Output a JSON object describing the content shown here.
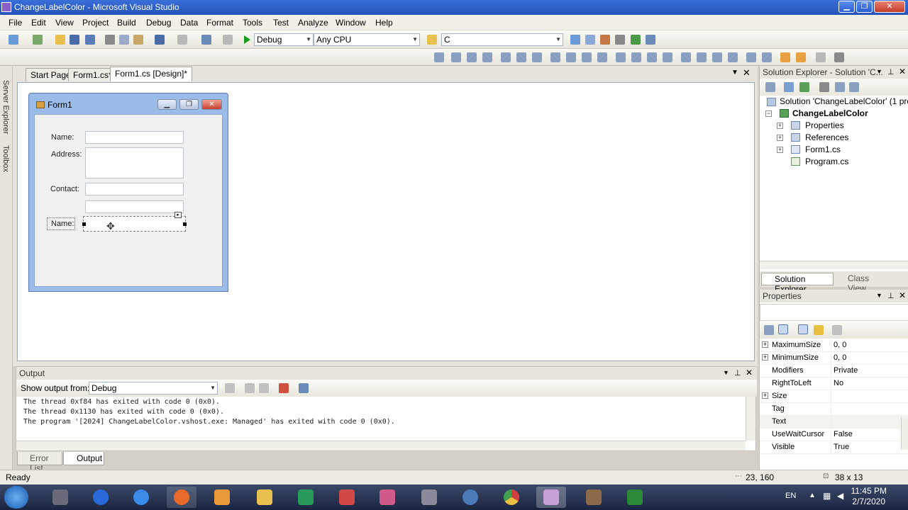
{
  "window": {
    "title": "ChangeLabelColor - Microsoft Visual Studio"
  },
  "menu": [
    "File",
    "Edit",
    "View",
    "Project",
    "Build",
    "Debug",
    "Data",
    "Format",
    "Tools",
    "Test",
    "Analyze",
    "Window",
    "Help"
  ],
  "toolbar": {
    "config": "Debug",
    "platform": "Any CPU",
    "find": "C"
  },
  "left_strip": {
    "server_explorer": "Server Explorer",
    "toolbox": "Toolbox"
  },
  "doc_tabs": [
    "Start Page",
    "Form1.cs*",
    "Form1.cs [Design]*"
  ],
  "form": {
    "title": "Form1",
    "labels": {
      "name": "Name:",
      "address": "Address:",
      "contact": "Contact:",
      "name2": "Name:"
    }
  },
  "solution_explorer": {
    "header": "Solution Explorer - Solution 'C...",
    "solution": "Solution 'ChangeLabelColor' (1 proje",
    "project": "ChangeLabelColor",
    "items": [
      "Properties",
      "References",
      "Form1.cs",
      "Program.cs"
    ],
    "tabs": [
      "Solution Explorer",
      "Class View"
    ]
  },
  "properties": {
    "header": "Properties",
    "rows": [
      {
        "name": "MaximumSize",
        "value": "0, 0",
        "expand": true
      },
      {
        "name": "MinimumSize",
        "value": "0, 0",
        "expand": true
      },
      {
        "name": "Modifiers",
        "value": "Private",
        "expand": false
      },
      {
        "name": "RightToLeft",
        "value": "No",
        "expand": false
      },
      {
        "name": "Size",
        "value": "",
        "expand": true
      },
      {
        "name": "Tag",
        "value": "",
        "expand": false
      },
      {
        "name": "Text",
        "value": "",
        "expand": false
      },
      {
        "name": "UseWaitCursor",
        "value": "False",
        "expand": false
      },
      {
        "name": "Visible",
        "value": "True",
        "expand": false
      }
    ]
  },
  "output": {
    "header": "Output",
    "show_from_label": "Show output from:",
    "show_from_value": "Debug",
    "lines": [
      "The thread 0xf84 has exited with code 0 (0x0).",
      "The thread 0x1130 has exited with code 0 (0x0).",
      "The program '[2024] ChangeLabelColor.vshost.exe: Managed' has exited with code 0 (0x0)."
    ]
  },
  "bottom_tabs": [
    "Error List",
    "Output"
  ],
  "status": {
    "text": "Ready",
    "position": "23, 160",
    "size": "38 x 13"
  },
  "taskbar": {
    "lang": "EN",
    "time": "11:45 PM",
    "date": "2/7/2020"
  }
}
